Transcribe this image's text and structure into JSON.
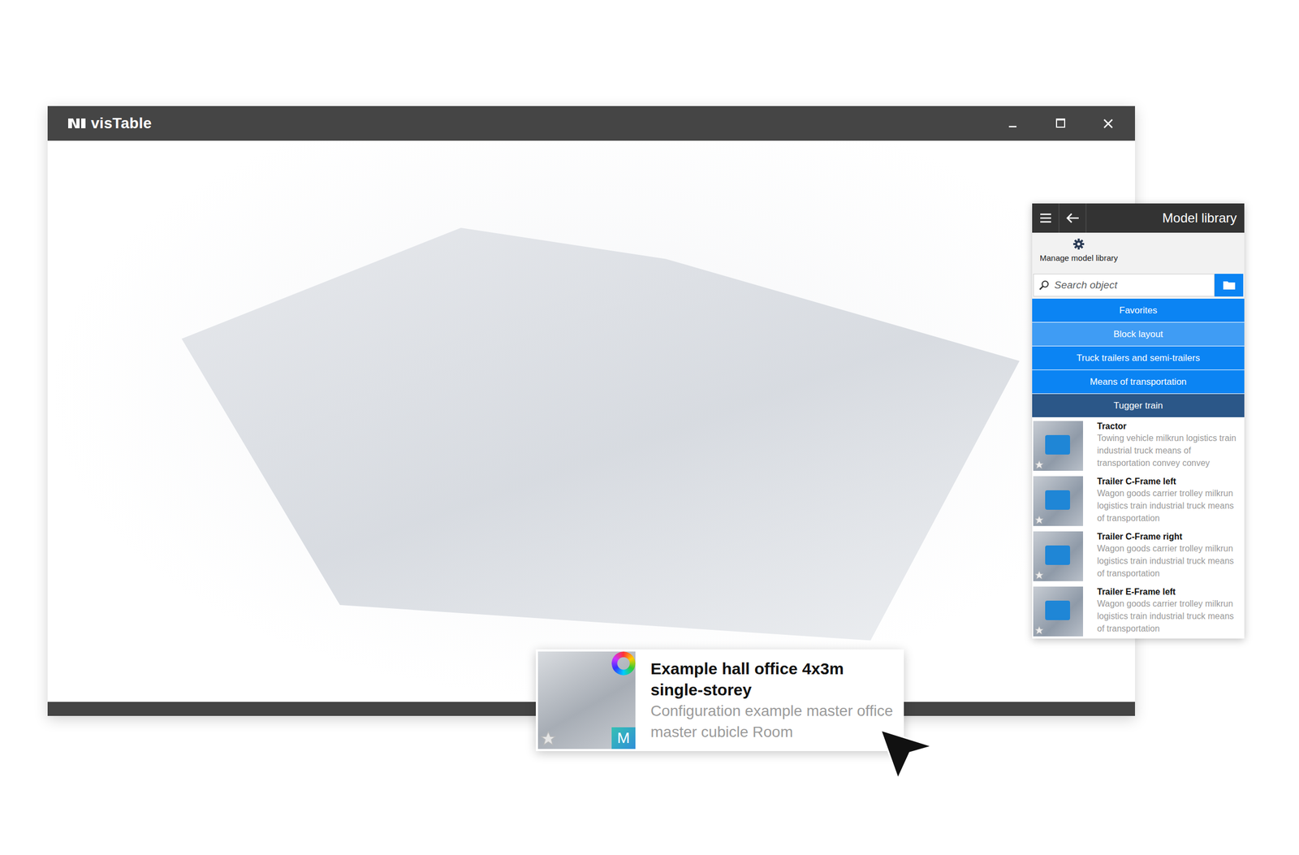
{
  "window": {
    "title": "visTable"
  },
  "library": {
    "title": "Model library",
    "manage": "Manage model library",
    "search": {
      "placeholder": "Search object"
    },
    "categories": [
      {
        "label": "Favorites",
        "highlighted": false,
        "selected": false
      },
      {
        "label": "Block layout",
        "highlighted": true,
        "selected": false
      },
      {
        "label": "Truck trailers and semi-trailers",
        "highlighted": false,
        "selected": false
      },
      {
        "label": "Means of transportation",
        "highlighted": false,
        "selected": false
      },
      {
        "label": "Tugger train",
        "highlighted": false,
        "selected": true
      }
    ],
    "items": [
      {
        "name": "Tractor",
        "description": "Towing vehicle milkrun logistics train industrial truck means of transportation convey convey"
      },
      {
        "name": "Trailer C-Frame left",
        "description": "Wagon goods carrier trolley milkrun logistics train industrial truck means of transportation"
      },
      {
        "name": "Trailer C-Frame right",
        "description": "Wagon goods carrier trolley milkrun logistics train industrial truck means of transportation"
      },
      {
        "name": "Trailer E-Frame left",
        "description": "Wagon goods carrier trolley milkrun logistics train industrial truck means of transportation"
      }
    ]
  },
  "tooltip": {
    "title": "Example hall office 4x3m single-storey",
    "description": "Configuration example master office master cubicle Room",
    "badge": "M"
  }
}
